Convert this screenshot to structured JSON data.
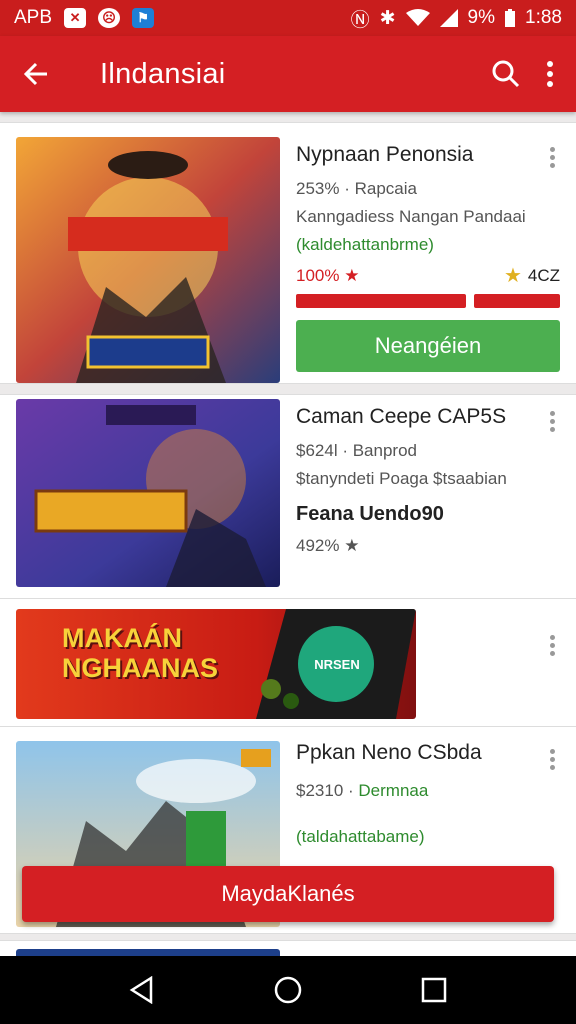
{
  "status": {
    "carrier": "APB",
    "time": "1:88",
    "battery": "9%"
  },
  "app_bar": {
    "title": "Ilndansiai"
  },
  "items": [
    {
      "title": "Nypnaan Penonsia",
      "line1": "253% · Rapcaia",
      "line2": "Kanngadiess Nangan Pandaai",
      "line3": "(kaldehattanbrme)",
      "percent": "100% ★",
      "rating": "4CZ",
      "progress": 1.0,
      "install_label": "Neangéien"
    },
    {
      "title": "Caman  Ceepe CAP5S",
      "line1": "$624l · Banprod",
      "line2": "$tanyndeti Poaga $tsaabian",
      "bold": "Feana Uendo90",
      "line3": "492% ★"
    },
    {
      "banner_title_1": "MAKAÁN",
      "banner_title_2": "NGHAANAS",
      "banner_badge": "NRSEN"
    },
    {
      "title": "Ppkan Neno CSbda",
      "line1": "$2310 · ",
      "line1_green": "Dermnaa",
      "line3": "(taldahattabame)"
    }
  ],
  "floating_button": "MaydaKlanés",
  "colors": {
    "primary": "#d41f23",
    "install": "#4caf50"
  }
}
